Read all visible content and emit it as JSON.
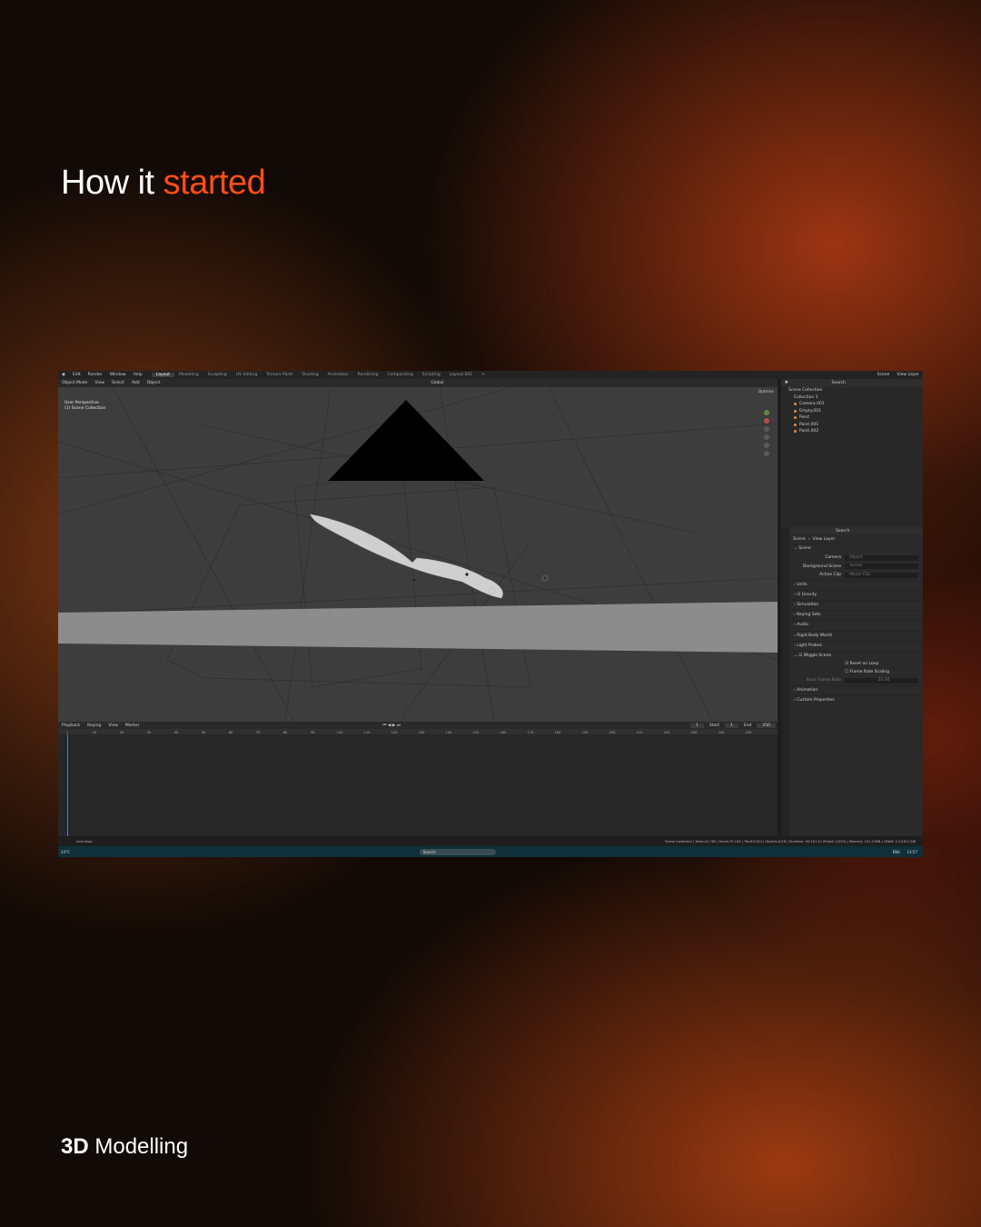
{
  "headline": {
    "lead": "How it ",
    "accent": "started"
  },
  "footer": {
    "bold": "3D",
    "rest": " Modelling"
  },
  "blender": {
    "menus": [
      "Edit",
      "Render",
      "Window",
      "Help"
    ],
    "workspaces": [
      "Layout",
      "Modelling",
      "Sculpting",
      "UV Editing",
      "Texture Paint",
      "Shading",
      "Animation",
      "Rendering",
      "Compositing",
      "Scripting",
      "Layout.001"
    ],
    "scene_label": "Scene",
    "view_layer_label": "View Layer",
    "header": {
      "mode": "Object Mode",
      "view": "View",
      "select": "Select",
      "add": "Add",
      "object": "Object",
      "orientation": "Global",
      "options": "Options"
    },
    "viewport": {
      "perspective": "User Perspective",
      "collection": "(1) Scene Collection"
    },
    "outliner": {
      "search_placeholder": "Search",
      "items": [
        "Scene Collection",
        "Collection 1",
        "Camera.001",
        "Empty.001",
        "Point",
        "Point.001",
        "Point.002"
      ]
    },
    "properties": {
      "search_placeholder": "Search",
      "breadcrumb_scene": "Scene",
      "breadcrumb_view_layer": "View Layer",
      "scene_section": "Scene",
      "camera_label": "Camera",
      "camera_value": "Object",
      "background_label": "Background Scene",
      "background_value": "Scene",
      "active_clip_label": "Active Clip",
      "active_clip_value": "Movie Clip",
      "sections": [
        "Units",
        "Gravity",
        "Simulation",
        "Keying Sets",
        "Audio",
        "Rigid Body World",
        "Light Probes",
        "Wiggle Scene"
      ],
      "wiggle": {
        "reset": "Reset on Loop",
        "frame_rate": "Frame Rate Scaling",
        "base_label": "Base Frame Rate",
        "base_value": "24.00"
      },
      "bottom_sections": [
        "Animation",
        "Custom Properties"
      ]
    },
    "timeline": {
      "menus": [
        "Playback",
        "Keying",
        "View",
        "Marker"
      ],
      "current_frame": "1",
      "start_label": "Start",
      "start_value": "1",
      "end_label": "End",
      "end_value": "250",
      "ticks": [
        "1",
        "10",
        "20",
        "30",
        "40",
        "50",
        "60",
        "70",
        "80",
        "90",
        "100",
        "110",
        "120",
        "130",
        "140",
        "150",
        "160",
        "170",
        "180",
        "190",
        "200",
        "210",
        "220",
        "230",
        "240",
        "250"
      ]
    },
    "status": {
      "left": "Axis Snap",
      "right": "Scene Collection | Verts:41,762 | Faces:79,159 | Tris:83,244 | Objects:0/16 | Duration: 00:10+10 (Frame 1/250) | Memory: 101.3 MiB | VRAM: 2.2/16.0 GiB"
    },
    "taskbar": {
      "temp": "24°C",
      "search": "Search",
      "lang": "ENG",
      "time": "13:57"
    }
  }
}
